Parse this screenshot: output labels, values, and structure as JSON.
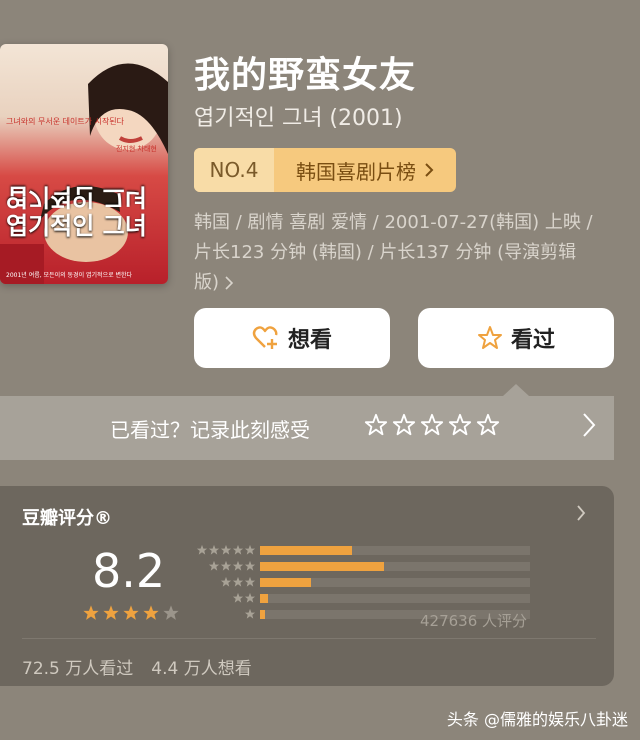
{
  "movie": {
    "title": "我的野蛮女友",
    "original_title": "엽기적인 그녀 (2001)",
    "rank_no": "NO.4",
    "rank_list": "韩国喜剧片榜",
    "meta_line1": "韩国 / 剧情 喜剧 爱情 / 2001-07-27(韩国) 上映 /",
    "meta_line2": "片长123 分钟 (韩国) / 片长137 分钟 (导演剪辑",
    "meta_line3": "版)",
    "poster": {
      "tagline": "그녀와의 무서운 데이트가 시작된다",
      "title_upside": "엽기적인 그녀",
      "title": "엽기적인 그녀",
      "credits": "2001년 여름, 모든이의 동경이 엽기적으로 변한다",
      "small": "전지현 차태현"
    }
  },
  "actions": {
    "want_label": "想看",
    "seen_label": "看过"
  },
  "seen_prompt": {
    "text": "已看过？记录此刻感受"
  },
  "rating": {
    "label": "豆瓣评分®",
    "score": "8.2",
    "stars_filled": 4,
    "distribution_percent": [
      34,
      46,
      19,
      3,
      2
    ],
    "count_text": "427636 人评分",
    "watched_text": "72.5 万人看过",
    "want_text": "4.4 万人想看"
  },
  "watermark": "头条 @儒雅的娱乐八卦迷",
  "colors": {
    "background": "#8c857a",
    "accent_orange": "#efa23f",
    "rank_badge": "#f6c97e"
  }
}
